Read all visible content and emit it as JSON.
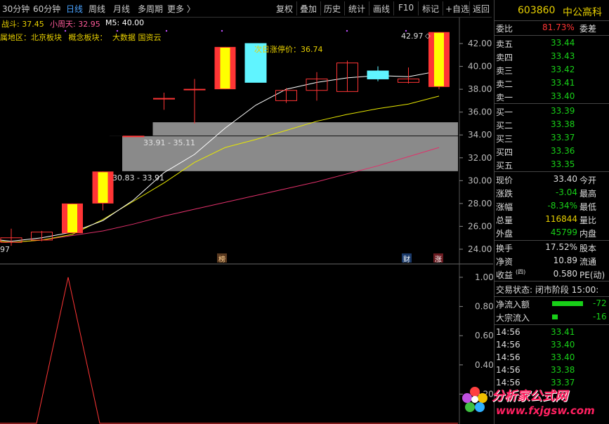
{
  "toolbar": {
    "left_items": [
      "30分钟",
      "60分钟",
      "日线",
      "周线",
      "月线",
      "多周期",
      "更多 〉"
    ],
    "active_index": 2,
    "right_items": [
      "复权",
      "叠加",
      "历史",
      "统计",
      "画线",
      "F10",
      "标记",
      "+自选",
      "返回"
    ]
  },
  "indicator_legend": {
    "zhandou": "战斗: 37.45",
    "xiaozhoutian": "小周天: 32.95",
    "m5": "M5: 40.00"
  },
  "info_line": {
    "region": "所属地区：北京板块",
    "concept_label": "概念板块：",
    "concepts": "大数据 国资云"
  },
  "chart_texts": {
    "limit_up": "次日涨停价：36.74",
    "max_price": "42.97",
    "zone_upper": "33.91 - 35.11",
    "zone_lower": "30.83 - 33.91",
    "left_value": "97",
    "marker_bang": "榜",
    "marker_cai": "财",
    "marker_zhang": "涨"
  },
  "colors": {
    "up": "#ff3535",
    "down": "#18d018",
    "yellow_body": "#ffff00",
    "cyan_body": "#60f4ff",
    "zone": "#8a8a8a",
    "ma_white": "#ffffff",
    "ma_yellow": "#e8e800",
    "ma_pink": "#e0306a"
  },
  "chart_data": {
    "type": "candlestick",
    "ylim": [
      23,
      44
    ],
    "yticks": [
      "24.00",
      "26.00",
      "28.00",
      "30.00",
      "32.00",
      "34.00",
      "36.00",
      "38.00",
      "40.00",
      "42.00"
    ],
    "candles": [
      {
        "o": 24.6,
        "c": 25.0,
        "h": 25.8,
        "l": 24.3,
        "fill": "none"
      },
      {
        "o": 24.8,
        "c": 25.5,
        "h": 25.6,
        "l": 24.7,
        "fill": "none"
      },
      {
        "o": 25.4,
        "c": 28.0,
        "h": 28.0,
        "l": 25.4,
        "fill": "yellow"
      },
      {
        "o": 28.0,
        "c": 30.8,
        "h": 30.8,
        "l": 27.4,
        "fill": "yellow"
      },
      {
        "o": 33.9,
        "c": 33.9,
        "h": 33.9,
        "l": 33.9,
        "fill": "none"
      },
      {
        "o": 37.2,
        "c": 37.2,
        "h": 37.7,
        "l": 36.2,
        "fill": "none"
      },
      {
        "o": 38.0,
        "c": 38.0,
        "h": 38.9,
        "l": 35.0,
        "fill": "none"
      },
      {
        "o": 38.0,
        "c": 41.7,
        "h": 41.7,
        "l": 38.0,
        "fill": "yellow"
      },
      {
        "o": 42.0,
        "c": 38.6,
        "h": 42.0,
        "l": 38.6,
        "fill": "cyan"
      },
      {
        "o": 37.0,
        "c": 37.9,
        "h": 38.1,
        "l": 36.8,
        "fill": "none"
      },
      {
        "o": 37.9,
        "c": 38.9,
        "h": 39.5,
        "l": 37.0,
        "fill": "none"
      },
      {
        "o": 37.8,
        "c": 40.3,
        "h": 40.5,
        "l": 37.8,
        "fill": "none"
      },
      {
        "o": 39.6,
        "c": 38.9,
        "h": 40.0,
        "l": 38.7,
        "fill": "cyan"
      },
      {
        "o": 38.6,
        "c": 38.9,
        "h": 39.9,
        "l": 38.5,
        "fill": "none"
      },
      {
        "o": 38.2,
        "c": 43.0,
        "h": 43.0,
        "l": 38.0,
        "fill": "yellow"
      }
    ],
    "ma_white": [
      24.7,
      25.0,
      25.5,
      26.5,
      28.3,
      30.7,
      32.3,
      34.6,
      36.6,
      38.0,
      38.6,
      39.0,
      39.2,
      39.1,
      39.6
    ],
    "ma_yellow": [
      24.6,
      24.8,
      25.3,
      26.6,
      28.2,
      29.8,
      31.6,
      32.9,
      33.6,
      34.4,
      35.2,
      35.8,
      36.3,
      36.7,
      37.4
    ],
    "ma_pink": [
      24.6,
      24.8,
      25.2,
      25.6,
      26.2,
      26.9,
      27.5,
      28.1,
      28.7,
      29.3,
      29.9,
      30.6,
      31.3,
      32.1,
      32.9
    ],
    "zones": [
      {
        "from": 30.83,
        "to": 33.91,
        "start": 4
      },
      {
        "from": 33.91,
        "to": 35.11,
        "start": 5
      }
    ],
    "lower": {
      "ylim": [
        0,
        1.1
      ],
      "yticks": [
        "0.20",
        "0.40",
        "0.60",
        "0.80",
        "1.00"
      ],
      "values": [
        0,
        0,
        1,
        0,
        0,
        0,
        0,
        0,
        0,
        0,
        0,
        0,
        0,
        0,
        0
      ]
    }
  },
  "quote_panel": {
    "code": "603860",
    "name": "中公高科",
    "weibi": {
      "label": "委比",
      "value": "81.73%",
      "label2": "委差"
    },
    "asks": [
      {
        "label": "卖五",
        "price": "33.44"
      },
      {
        "label": "卖四",
        "price": "33.43"
      },
      {
        "label": "卖三",
        "price": "33.42"
      },
      {
        "label": "卖二",
        "price": "33.41"
      },
      {
        "label": "卖一",
        "price": "33.40"
      }
    ],
    "bids": [
      {
        "label": "买一",
        "price": "33.39"
      },
      {
        "label": "买二",
        "price": "33.38"
      },
      {
        "label": "买三",
        "price": "33.37"
      },
      {
        "label": "买四",
        "price": "33.36"
      },
      {
        "label": "买五",
        "price": "33.35"
      }
    ],
    "stats": [
      {
        "label": "现价",
        "value": "33.40",
        "label2": "今开"
      },
      {
        "label": "涨跌",
        "value": "-3.04",
        "label2": "最高"
      },
      {
        "label": "涨幅",
        "value": "-8.34%",
        "label2": "最低"
      },
      {
        "label": "总量",
        "value": "116844",
        "label2": "量比"
      },
      {
        "label": "外盘",
        "value": "45799",
        "label2": "内盘"
      }
    ],
    "stats2": [
      {
        "label": "换手",
        "value": "17.52%",
        "label2": "股本"
      },
      {
        "label": "净资",
        "value": "10.89",
        "label2": "流通"
      },
      {
        "label": "收益",
        "sup": "(四)",
        "value": "0.580",
        "label2": "PE(动)"
      }
    ],
    "trade_status": "交易状态: 闭市阶段 15:00:",
    "flows": [
      {
        "label": "净流入额",
        "value": "-72",
        "bar": 0.55
      },
      {
        "label": "大宗流入",
        "value": "-16",
        "bar": 0.1
      }
    ],
    "ticks": [
      {
        "time": "14:56",
        "price": "33.41"
      },
      {
        "time": "14:56",
        "price": "33.40"
      },
      {
        "time": "14:56",
        "price": "33.40"
      },
      {
        "time": "14:56",
        "price": "33.38"
      },
      {
        "time": "14:56",
        "price": "33.37"
      }
    ]
  },
  "watermark": {
    "title": "分析家公式网",
    "url": "www.fxjgsw.com"
  }
}
